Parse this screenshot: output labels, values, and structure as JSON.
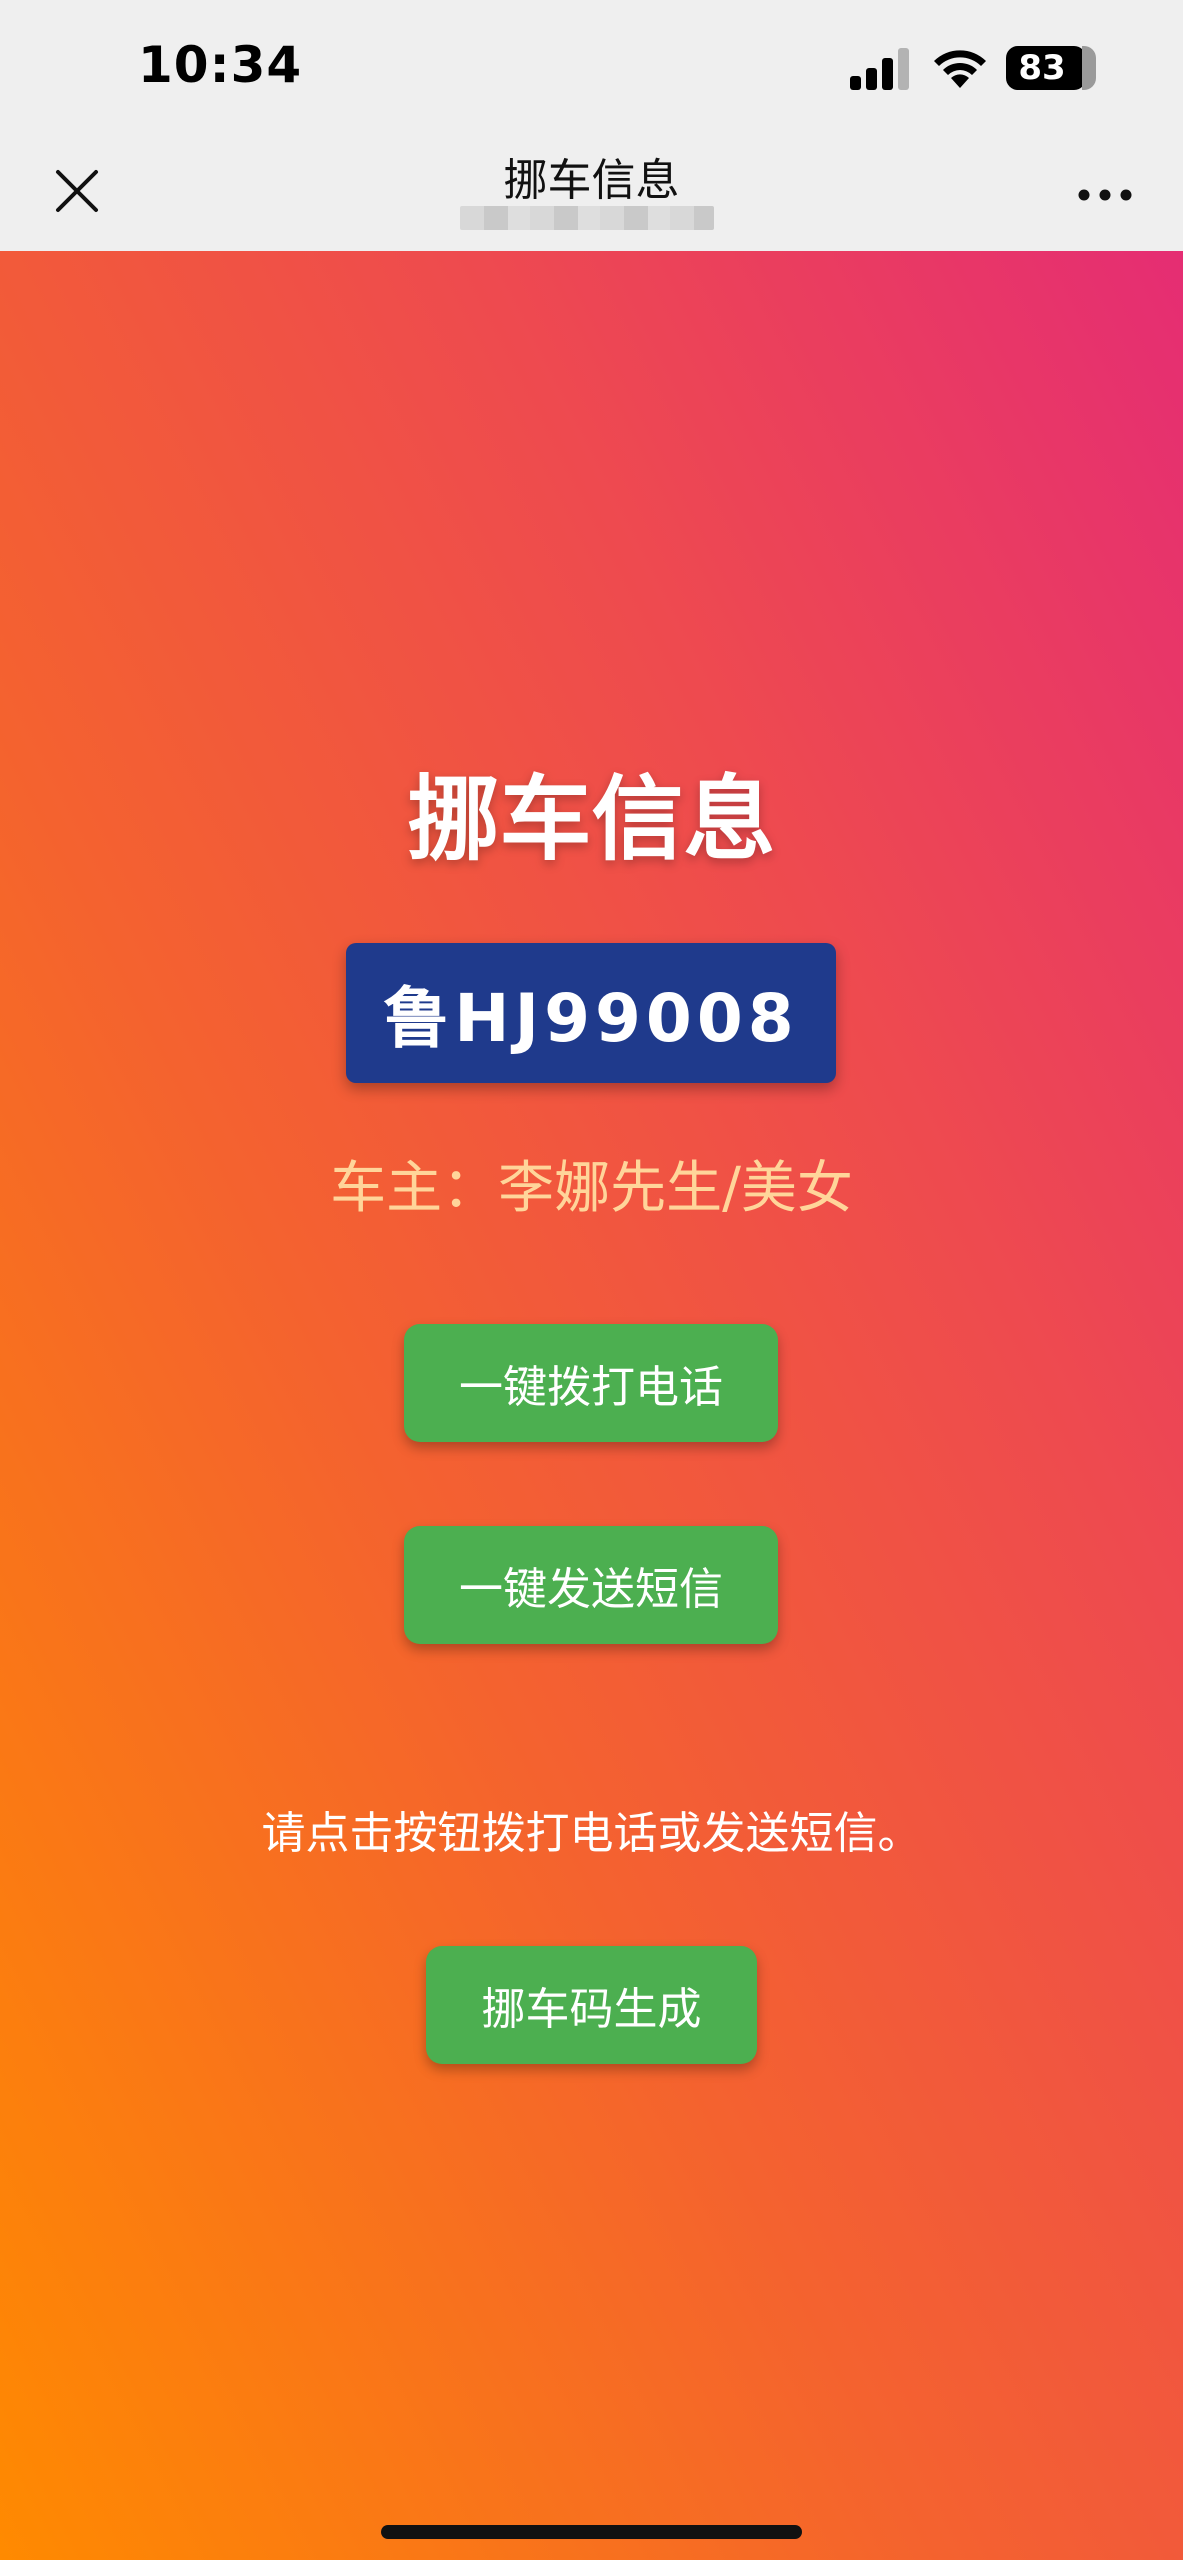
{
  "status_bar": {
    "time": "10:34",
    "battery_level": "83",
    "icons": [
      "signal-icon",
      "wifi-icon",
      "battery-icon"
    ]
  },
  "nav": {
    "title": "挪车信息",
    "close_icon": "close-icon",
    "more_icon": "more-icon"
  },
  "main": {
    "title": "挪车信息",
    "plate_number": "鲁HJ99008",
    "owner_text": "车主：李娜先生/美女",
    "call_button": "一键拨打电话",
    "sms_button": "一键发送短信",
    "hint": "请点击按钮拨打电话或发送短信。",
    "generate_button": "挪车码生成"
  },
  "colors": {
    "plate_bg": "#1f3a8c",
    "button_bg": "#4caf50",
    "owner_text": "#ffd59a",
    "gradient_start": "#ff8a00",
    "gradient_end": "#e52d73"
  }
}
